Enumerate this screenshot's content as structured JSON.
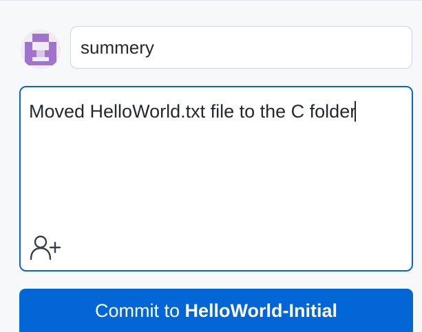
{
  "commit": {
    "summary_value": "summery",
    "description_value": "Moved HelloWorld.txt file to the C folder",
    "button_prefix": "Commit to ",
    "branch_name": "HelloWorld-Initial"
  },
  "icons": {
    "avatar": "identicon-avatar",
    "coauthor": "add-coauthor-icon"
  },
  "colors": {
    "accent": "#0366d6",
    "avatar": "#a073cc",
    "background": "#f6f8fa"
  }
}
